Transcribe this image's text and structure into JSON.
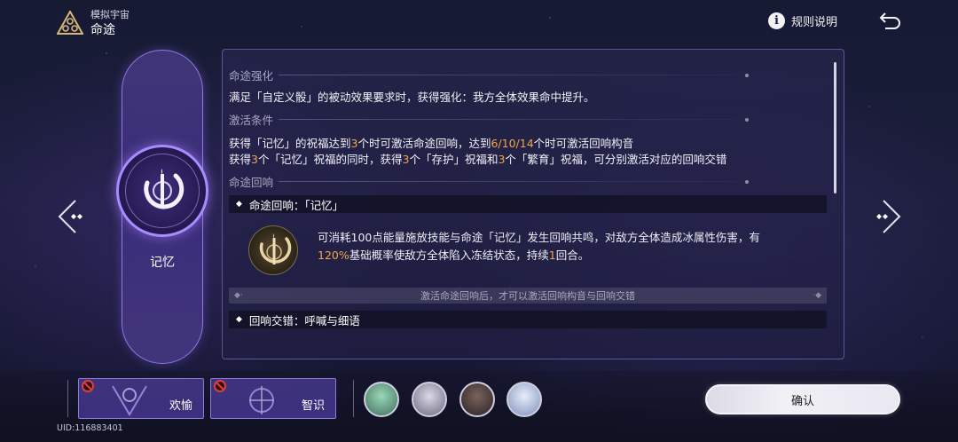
{
  "header": {
    "subtitle": "模拟宇宙",
    "title": "命途",
    "rules_label": "规则说明",
    "rules_icon": "info-icon",
    "back_icon": "back-arrow-icon"
  },
  "path": {
    "name": "记忆",
    "emblem_icon": "remembrance-path-icon",
    "prev_icon": "chevron-left-icon",
    "next_icon": "chevron-right-icon"
  },
  "panel": {
    "enhance_title": "命途强化",
    "enhance_text": "满足「自定义骰」的被动效果要求时，获得强化：我方全体效果命中提升。",
    "condition_title": "激活条件",
    "condition_line1": {
      "a": "获得「记忆」的祝福达到",
      "b": "3",
      "c": "个时可激活命途回响，达到",
      "d": "6/10/14",
      "e": "个时可激活回响构音"
    },
    "condition_line2": {
      "a": "获得",
      "b": "3",
      "c": "个「记忆」祝福的同时，获得",
      "d": "3",
      "e": "个「存护」祝福和",
      "f": "3",
      "g": "个「繁育」祝福，可分别激活对应的回响交错"
    },
    "echo_section_title": "命途回响",
    "echo_header": "命途回响：「记忆」",
    "echo_desc": {
      "a": "可消耗100点能量施放技能与命途「记忆」发生回响共鸣，对敌方全体造成冰属性伤害，有",
      "b": "120%",
      "c": "基础概率使敌方全体陷入冻结状态，持续",
      "d": "1",
      "e": "回合。"
    },
    "hint": "激活命途回响后，才可以激活回响构音与回响交错",
    "cross_header": "回响交错：呼喊与细语"
  },
  "abilities": [
    {
      "label": "欢愉",
      "locked": true,
      "icon": "elation-path-icon"
    },
    {
      "label": "智识",
      "locked": true,
      "icon": "erudition-path-icon"
    }
  ],
  "team": [
    {
      "name": "team-member-1",
      "color": "#7fc7a4"
    },
    {
      "name": "team-member-2",
      "color": "#b9b6c8"
    },
    {
      "name": "team-member-3",
      "color": "#5a4a46"
    },
    {
      "name": "team-member-4",
      "color": "#c9d6ee"
    }
  ],
  "confirm_label": "确认",
  "uid": "UID:116883401",
  "colors": {
    "accent": "#a88cff",
    "highlight": "#f0a64a",
    "lock": "#e03d3d"
  }
}
